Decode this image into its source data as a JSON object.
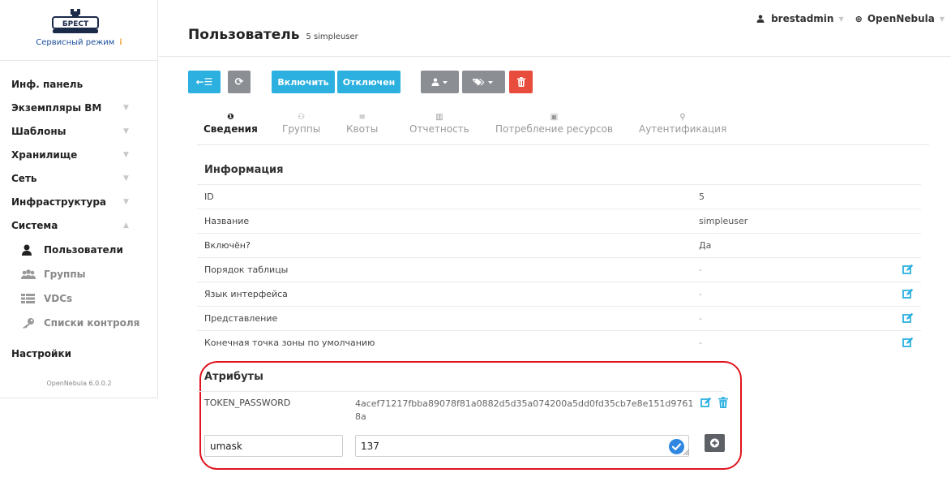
{
  "sidebar": {
    "service_mode": "Сервисный режим",
    "service_mode_icon": "i",
    "nav": [
      {
        "label": "Инф. панель"
      },
      {
        "label": "Экземпляры ВМ"
      },
      {
        "label": "Шаблоны"
      },
      {
        "label": "Хранилище"
      },
      {
        "label": "Сеть"
      },
      {
        "label": "Инфраструктура"
      },
      {
        "label": "Система"
      }
    ],
    "system_sub": [
      {
        "label": "Пользователи"
      },
      {
        "label": "Группы"
      },
      {
        "label": "VDCs"
      },
      {
        "label": "Списки контроля"
      }
    ],
    "settings": "Настройки",
    "version": "OpenNebula 6.0.0.2"
  },
  "header": {
    "title": "Пользователь",
    "subtitle": "5 simpleuser",
    "user": "brestadmin",
    "zone": "OpenNebula"
  },
  "toolbar": {
    "back_glyph": "←☰",
    "refresh_glyph": "⟳",
    "enable": "Включить",
    "disable": "Отключен"
  },
  "tabs": [
    {
      "label": "Сведения",
      "icon": "❶"
    },
    {
      "label": "Группы",
      "icon": "⚇"
    },
    {
      "label": "Квоты",
      "icon": "≡"
    },
    {
      "label": "Отчетность",
      "icon": "▥"
    },
    {
      "label": "Потребление ресурсов",
      "icon": "▣"
    },
    {
      "label": "Аутентификация",
      "icon": "⚲"
    }
  ],
  "info": {
    "title": "Информация",
    "rows": [
      {
        "key": "ID",
        "value": "5"
      },
      {
        "key": "Название",
        "value": "simpleuser"
      },
      {
        "key": "Включён?",
        "value": "Да"
      },
      {
        "key": "Порядок таблицы",
        "value": "-"
      },
      {
        "key": "Язык интерфейса",
        "value": "-"
      },
      {
        "key": "Представление",
        "value": "-"
      },
      {
        "key": "Конечная точка зоны по умолчанию",
        "value": "-"
      }
    ]
  },
  "attributes": {
    "title": "Атрибуты",
    "rows": [
      {
        "key": "TOKEN_PASSWORD",
        "value": "4acef71217fbba89078f81a0882d5d35a074200a5dd0fd35cb7e8e151d97618a"
      }
    ],
    "new_key": "umask",
    "new_value": "137"
  },
  "colors": {
    "accent": "#2bb0e0",
    "gray_button": "#8b8e93",
    "danger": "#e74c3c",
    "highlight_ring": "#e0141e"
  }
}
